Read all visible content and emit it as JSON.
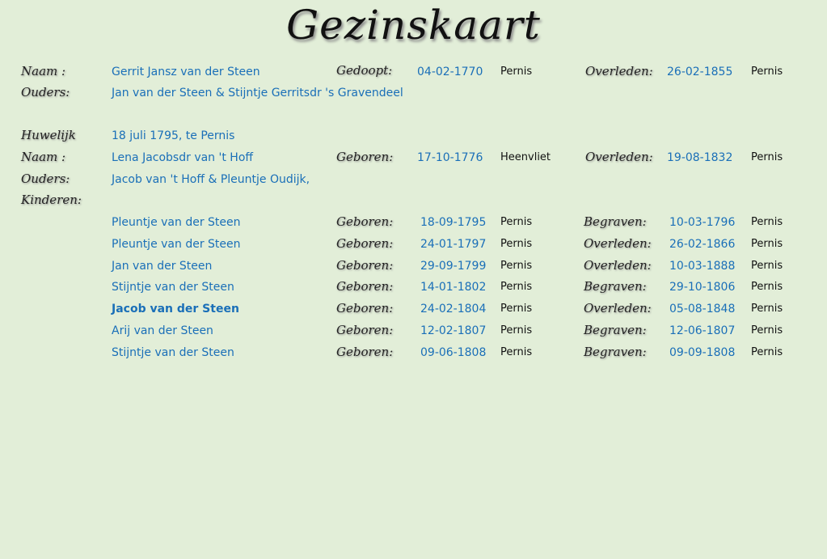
{
  "title": "Gezinskaart",
  "labels": {
    "naam": "Naam :",
    "ouders": "Ouders:",
    "huwelijk": "Huwelijk",
    "kinderen": "Kinderen:",
    "gedoopt": "Gedoopt:",
    "geboren": "Geboren:",
    "overleden": "Overleden:",
    "begraven": "Begraven:"
  },
  "husband": {
    "name": "Gerrit Jansz van der Steen",
    "event_label": "Gedoopt:",
    "event_date": "04-02-1770",
    "event_place": "Pernis",
    "death_label": "Overleden:",
    "death_date": "26-02-1855",
    "death_place": "Pernis",
    "parents": "Jan van der Steen & Stijntje Gerritsdr 's Gravendeel"
  },
  "marriage": "18 juli 1795, te Pernis",
  "wife": {
    "name": "Lena Jacobsdr van 't Hoff",
    "event_label": "Geboren:",
    "event_date": "17-10-1776",
    "event_place": "Heenvliet",
    "death_label": "Overleden:",
    "death_date": "19-08-1832",
    "death_place": "Pernis",
    "parents": "Jacob van 't Hoff & Pleuntje Oudijk,"
  },
  "children": [
    {
      "name": "Pleuntje van der Steen",
      "birth_label": "Geboren:",
      "birth_date": "18-09-1795",
      "birth_place": "Pernis",
      "end_label": "Begraven:",
      "end_date": "10-03-1796",
      "end_place": "Pernis",
      "bold": false
    },
    {
      "name": "Pleuntje van der Steen",
      "birth_label": "Geboren:",
      "birth_date": "24-01-1797",
      "birth_place": "Pernis",
      "end_label": "Overleden:",
      "end_date": "26-02-1866",
      "end_place": "Pernis",
      "bold": false
    },
    {
      "name": "Jan van der Steen",
      "birth_label": "Geboren:",
      "birth_date": "29-09-1799",
      "birth_place": "Pernis",
      "end_label": "Overleden:",
      "end_date": "10-03-1888",
      "end_place": "Pernis",
      "bold": false
    },
    {
      "name": "Stijntje van der Steen",
      "birth_label": "Geboren:",
      "birth_date": "14-01-1802",
      "birth_place": "Pernis",
      "end_label": "Begraven:",
      "end_date": "29-10-1806",
      "end_place": "Pernis",
      "bold": false
    },
    {
      "name": "Jacob van der Steen",
      "birth_label": "Geboren:",
      "birth_date": "24-02-1804",
      "birth_place": "Pernis",
      "end_label": "Overleden:",
      "end_date": "05-08-1848",
      "end_place": "Pernis",
      "bold": true
    },
    {
      "name": "Arij van der Steen",
      "birth_label": "Geboren:",
      "birth_date": "12-02-1807",
      "birth_place": "Pernis",
      "end_label": "Begraven:",
      "end_date": "12-06-1807",
      "end_place": "Pernis",
      "bold": false
    },
    {
      "name": "Stijntje van der Steen",
      "birth_label": "Geboren:",
      "birth_date": "09-06-1808",
      "birth_place": "Pernis",
      "end_label": "Begraven:",
      "end_date": "09-09-1808",
      "end_place": "Pernis",
      "bold": false
    }
  ]
}
